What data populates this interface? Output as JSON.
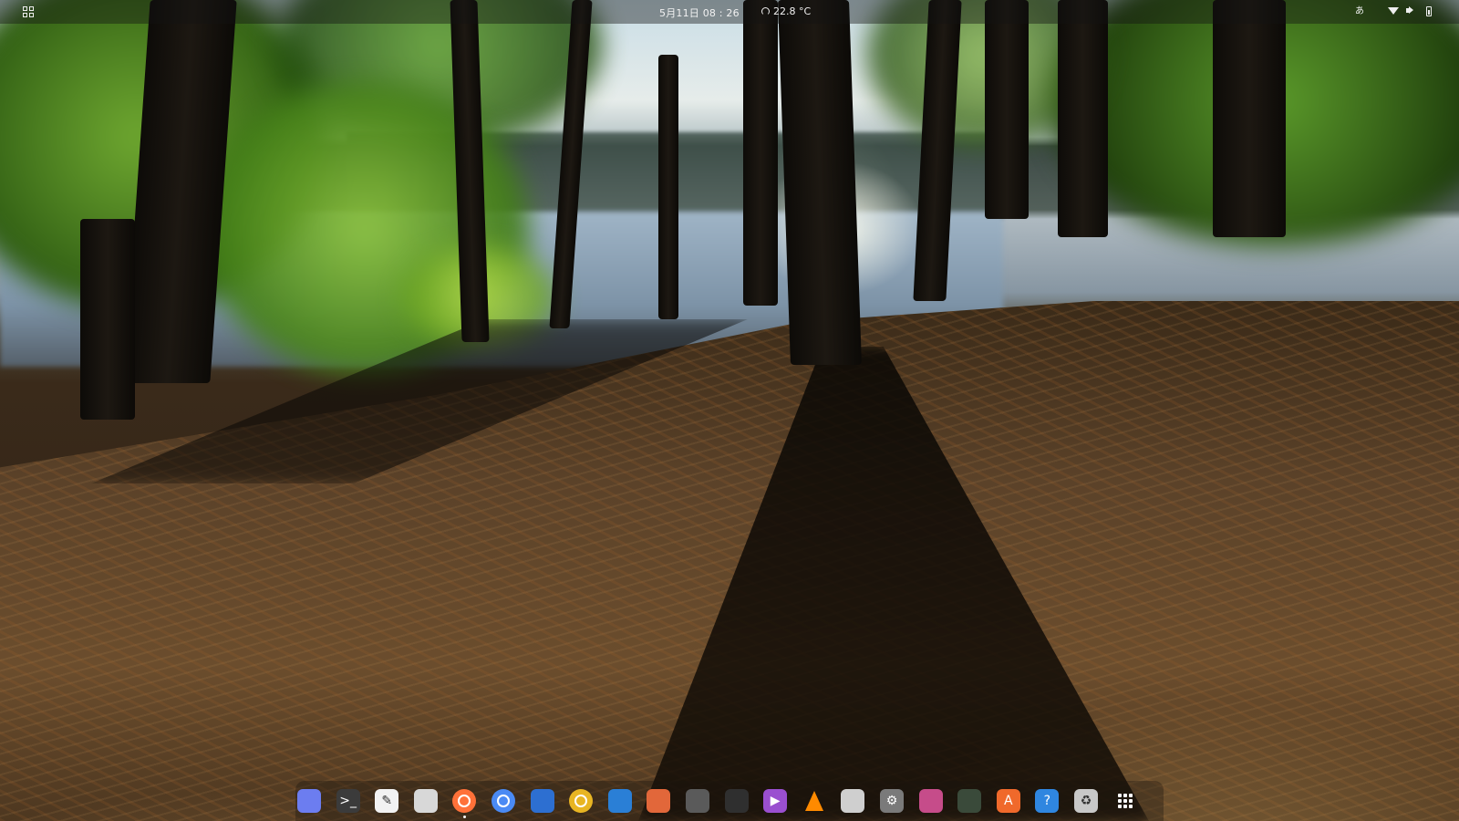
{
  "topbar": {
    "apps_icon": "apps-grid-icon",
    "clock": "5月11日 08 : 26",
    "weather_icon": "weather-cloud-icon",
    "temperature": "22.8 °C",
    "input_method": "あ",
    "status_icons": [
      "wifi-icon",
      "volume-icon",
      "battery-icon"
    ]
  },
  "dock": {
    "items": [
      {
        "name": "screenshot-tool",
        "icon": "screenshot-icon",
        "glyph": "",
        "color": "#6c7df0"
      },
      {
        "name": "terminal",
        "icon": "terminal-icon",
        "glyph": ">_",
        "color": "#3b3b3b"
      },
      {
        "name": "text-editor",
        "icon": "text-editor-icon",
        "glyph": "✎",
        "color": "#f2f2f2"
      },
      {
        "name": "files",
        "icon": "folder-icon",
        "glyph": "",
        "color": "#d8d8d8"
      },
      {
        "name": "firefox",
        "icon": "firefox-icon",
        "glyph": "",
        "color": "#ff7139",
        "running": true
      },
      {
        "name": "chromium",
        "icon": "chromium-icon",
        "glyph": "",
        "color": "#4a8af4"
      },
      {
        "name": "thunderbird",
        "icon": "mail-icon",
        "glyph": "",
        "color": "#2d6fd1"
      },
      {
        "name": "rhythmbox",
        "icon": "music-icon",
        "glyph": "",
        "color": "#e8b523"
      },
      {
        "name": "writer",
        "icon": "document-icon",
        "glyph": "",
        "color": "#2a7fd6"
      },
      {
        "name": "impress",
        "icon": "presentation-icon",
        "glyph": "",
        "color": "#e2673a"
      },
      {
        "name": "screen-recorder",
        "icon": "fish-icon",
        "glyph": "",
        "color": "#5a5a5a"
      },
      {
        "name": "inkscape",
        "icon": "vector-icon",
        "glyph": "",
        "color": "#2f2f2f"
      },
      {
        "name": "video-player",
        "icon": "play-icon",
        "glyph": "▶",
        "color": "#9a4fd0"
      },
      {
        "name": "vlc",
        "icon": "vlc-cone-icon",
        "glyph": "",
        "color": "#ff8a00"
      },
      {
        "name": "image-viewer",
        "icon": "image-viewer-icon",
        "glyph": "",
        "color": "#cfcfcf"
      },
      {
        "name": "settings",
        "icon": "gear-icon",
        "glyph": "⚙",
        "color": "#7a7a7a"
      },
      {
        "name": "tweaks",
        "icon": "toggle-icon",
        "glyph": "",
        "color": "#c64c8a"
      },
      {
        "name": "extensions",
        "icon": "puzzle-icon",
        "glyph": "",
        "color": "#3a4a3a"
      },
      {
        "name": "software-center",
        "icon": "app-store-icon",
        "glyph": "A",
        "color": "#f0692b"
      },
      {
        "name": "help",
        "icon": "help-icon",
        "glyph": "?",
        "color": "#2f86e0"
      },
      {
        "name": "trash",
        "icon": "trash-icon",
        "glyph": "♻",
        "color": "#c8c8c8"
      },
      {
        "name": "show-applications",
        "icon": "apps-grid-icon",
        "glyph": "",
        "color": "transparent"
      }
    ]
  }
}
